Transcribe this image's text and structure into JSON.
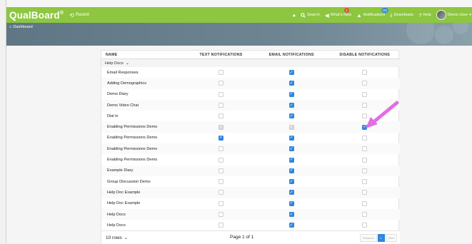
{
  "topbar": {
    "brand": "QualBoard",
    "brand_mark": "®",
    "recent_label": "Recent",
    "search_label": "Search",
    "whats_new_label": "What's New",
    "whats_new_badge": "1",
    "notifications_label": "Notifications",
    "notifications_badge": "101",
    "downloads_label": "Downloads",
    "help_label": "Help",
    "user_label": "Demo User"
  },
  "breadcrumb": {
    "label": "Dashboard"
  },
  "table": {
    "columns": [
      "NAME",
      "TEXT NOTIFICATIONS",
      "EMAIL NOTIFICATIONS",
      "DISABLE NOTIFICATIONS"
    ],
    "group_label": "Help Docs",
    "rows": [
      {
        "name": "Email Responses",
        "text": "off",
        "email": "on",
        "disable": "off"
      },
      {
        "name": "Adding Demographics",
        "text": "off",
        "email": "on",
        "disable": "off"
      },
      {
        "name": "Demo Diary",
        "text": "off",
        "email": "on",
        "disable": "off"
      },
      {
        "name": "Demo Video Chat",
        "text": "off",
        "email": "on",
        "disable": "off"
      },
      {
        "name": "Dial in",
        "text": "off",
        "email": "on",
        "disable": "off"
      },
      {
        "name": "Enabling Permissions Demo",
        "text": "dim",
        "email": "dim",
        "disable": "on"
      },
      {
        "name": "Enabling Permissions Demo",
        "text": "on",
        "email": "on",
        "disable": "off"
      },
      {
        "name": "Enabling Permissions Demo",
        "text": "off",
        "email": "on",
        "disable": "off"
      },
      {
        "name": "Enabling Permissions Demo",
        "text": "off",
        "email": "on",
        "disable": "off"
      },
      {
        "name": "Example Diary",
        "text": "off",
        "email": "on",
        "disable": "off"
      },
      {
        "name": "Group Discussion Demo",
        "text": "off",
        "email": "on",
        "disable": "off"
      },
      {
        "name": "Help Doc Example",
        "text": "off",
        "email": "on",
        "disable": "off"
      },
      {
        "name": "Help Doc Example",
        "text": "off",
        "email": "on",
        "disable": "off"
      },
      {
        "name": "Help Docs",
        "text": "off",
        "email": "on",
        "disable": "off"
      },
      {
        "name": "Help Docs",
        "text": "off",
        "email": "on",
        "disable": "off"
      }
    ]
  },
  "footer": {
    "rows_select": "10 rows",
    "page_info": "Page 1 of 1",
    "prev_label": "Previous",
    "current_page": "1",
    "next_label": "Next"
  },
  "colors": {
    "topbar": "#8dc63f",
    "accent": "#2e86de",
    "annotation_arrow": "#e06fe6"
  },
  "icons": [
    "history-icon",
    "chat-bubble-icon",
    "search-icon",
    "megaphone-icon",
    "bell-icon",
    "download-icon",
    "help-icon",
    "home-icon",
    "chevron-down-icon",
    "check-icon"
  ]
}
